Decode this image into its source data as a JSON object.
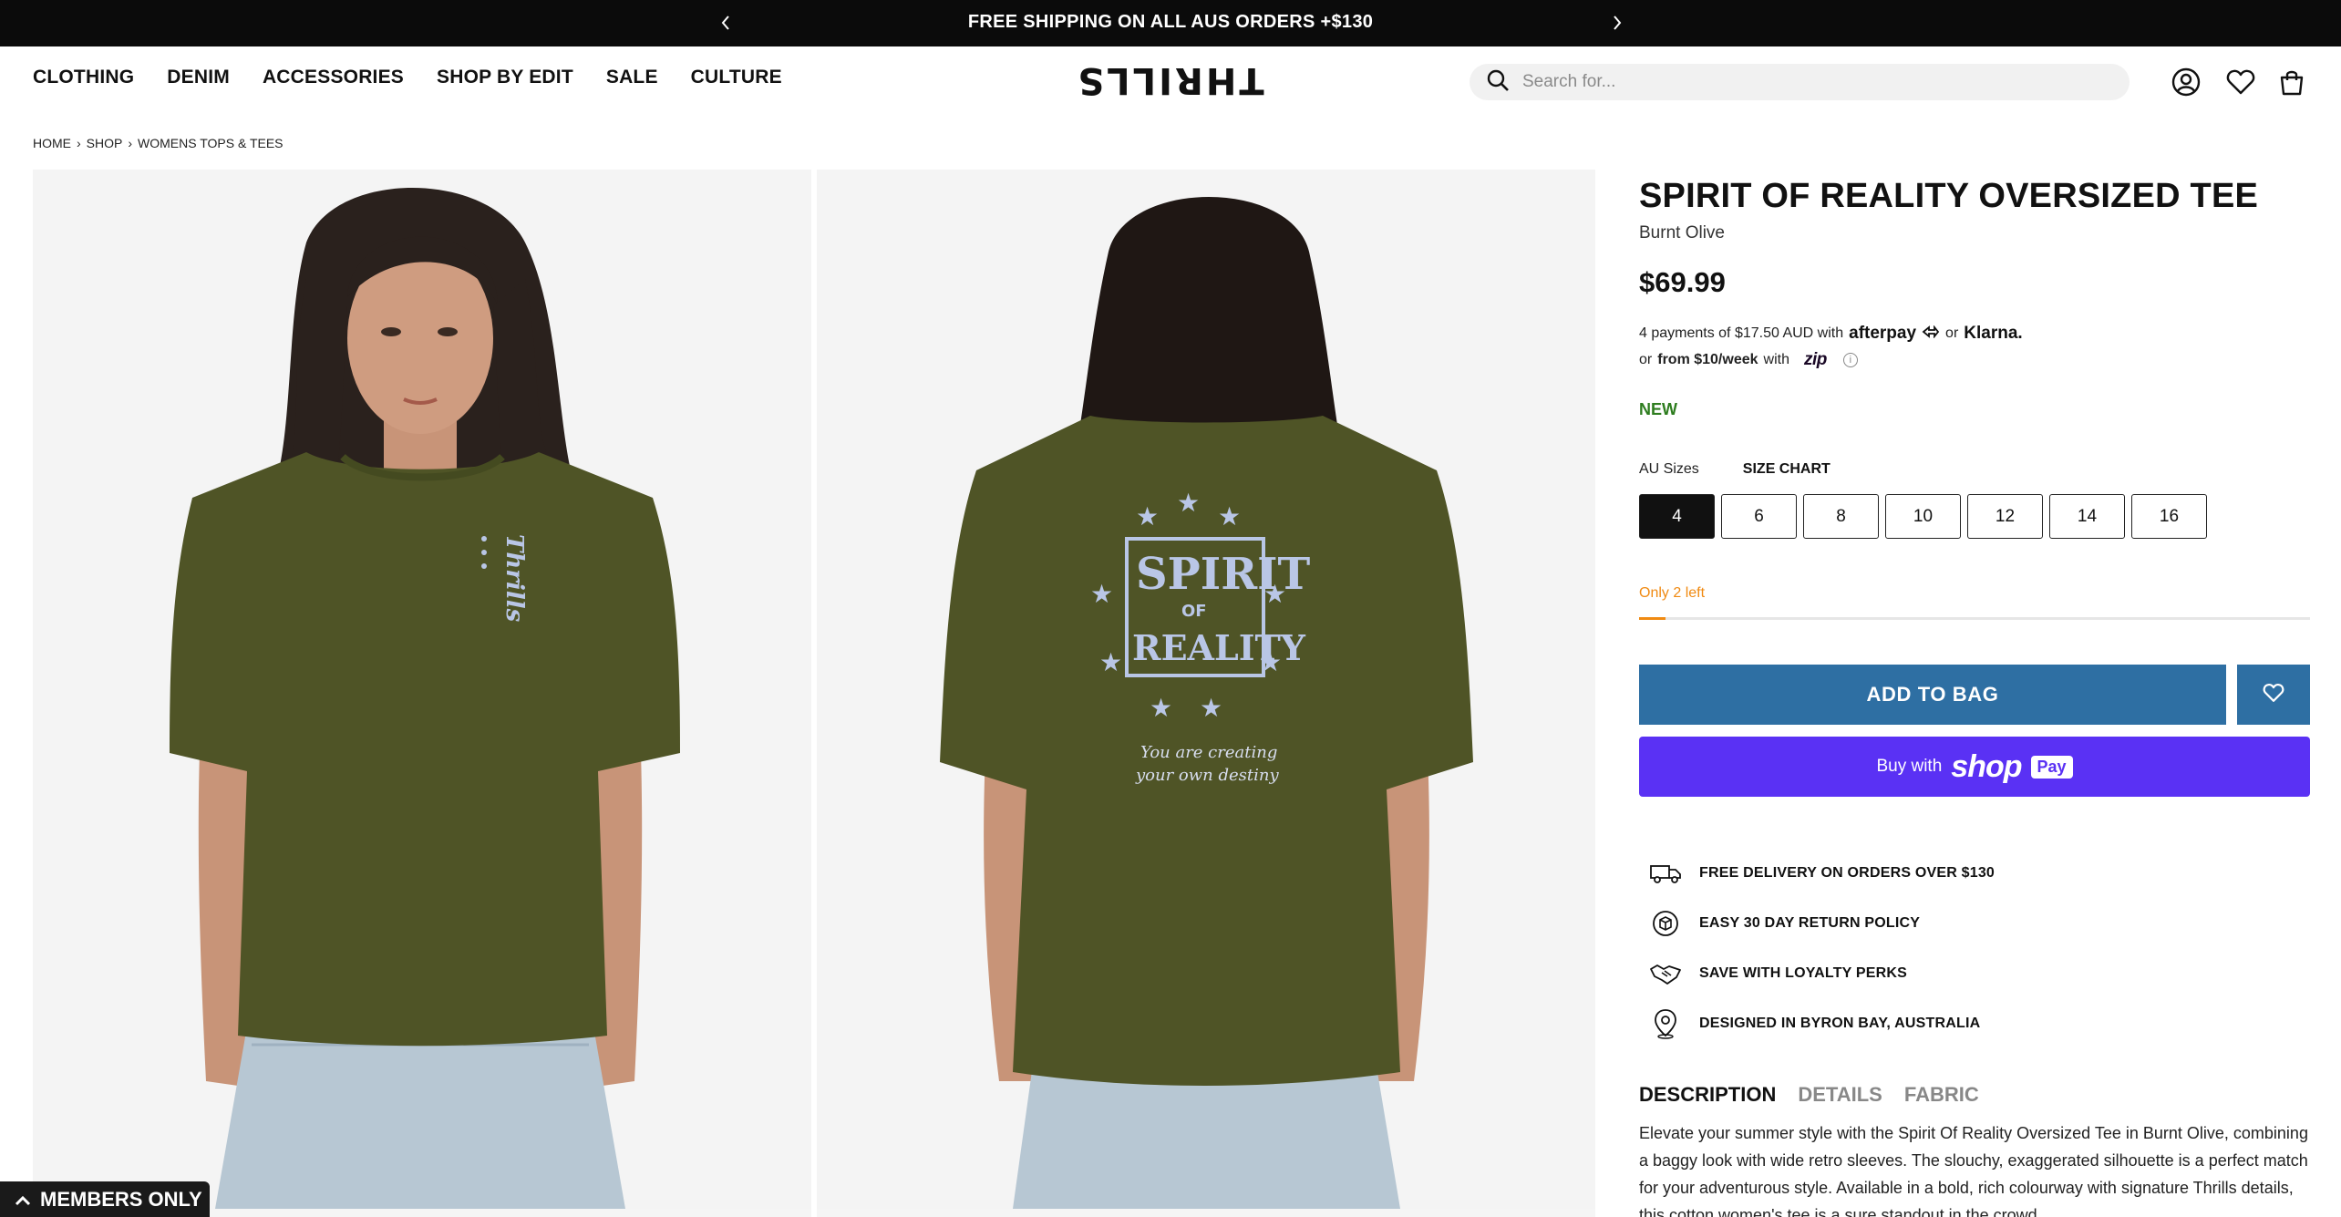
{
  "announcement": {
    "text": "FREE SHIPPING ON ALL AUS ORDERS +$130"
  },
  "nav": [
    "CLOTHING",
    "DENIM",
    "ACCESSORIES",
    "SHOP BY EDIT",
    "SALE",
    "CULTURE"
  ],
  "logo": {
    "text": "THRILLS"
  },
  "search": {
    "placeholder": "Search for..."
  },
  "breadcrumb": [
    "HOME",
    "SHOP",
    "WOMENS TOPS & TEES"
  ],
  "breadcrumb_separator": "›",
  "images": {
    "front_print": "Thrills",
    "back_print": {
      "line1": "SPIRIT",
      "line2": "OF",
      "line3": "REALITY",
      "tagline1": "You are creating",
      "tagline2": "your own destiny"
    }
  },
  "members_only": "MEMBERS ONLY",
  "product": {
    "title": "SPIRIT OF REALITY OVERSIZED TEE",
    "colour": "Burnt Olive",
    "price": "$69.99",
    "payments": {
      "line1_prefix": "4 payments of $17.50 AUD with",
      "afterpay": "afterpay",
      "or": "or",
      "klarna": "Klarna.",
      "line2_prefix": "or",
      "line2_amount": "from $10/week",
      "line2_with": "with",
      "zip": "zip"
    },
    "badge": "NEW",
    "sizes_label": "AU Sizes",
    "size_chart": "SIZE CHART",
    "sizes": [
      "4",
      "6",
      "8",
      "10",
      "12",
      "14",
      "16"
    ],
    "selected_size": "4",
    "stock_text": "Only 2 left",
    "stock_level": 0.04,
    "add_to_bag": "ADD TO BAG",
    "shop_pay": {
      "prefix": "Buy with",
      "shop": "shop",
      "pay": "Pay"
    },
    "perks": [
      "FREE DELIVERY ON ORDERS OVER $130",
      "EASY 30 DAY RETURN POLICY",
      "SAVE WITH LOYALTY PERKS",
      "DESIGNED IN BYRON BAY, AUSTRALIA"
    ],
    "tabs": [
      "DESCRIPTION",
      "DETAILS",
      "FABRIC"
    ],
    "active_tab": "DESCRIPTION",
    "description": "Elevate your summer style with the Spirit Of Reality Oversized Tee in Burnt Olive, combining a baggy look with wide retro sleeves. The slouchy, exaggerated silhouette is a perfect match for your adventurous style. Available in a bold, rich colourway with signature Thrills details, this cotton women's tee is a sure standout in the crowd."
  },
  "colors": {
    "accent_blue": "#2e6fa3",
    "shop_pay": "#5a31f4",
    "new_green": "#2e7d1f",
    "stock_orange": "#f08a12",
    "shirt": "#4f5426"
  }
}
